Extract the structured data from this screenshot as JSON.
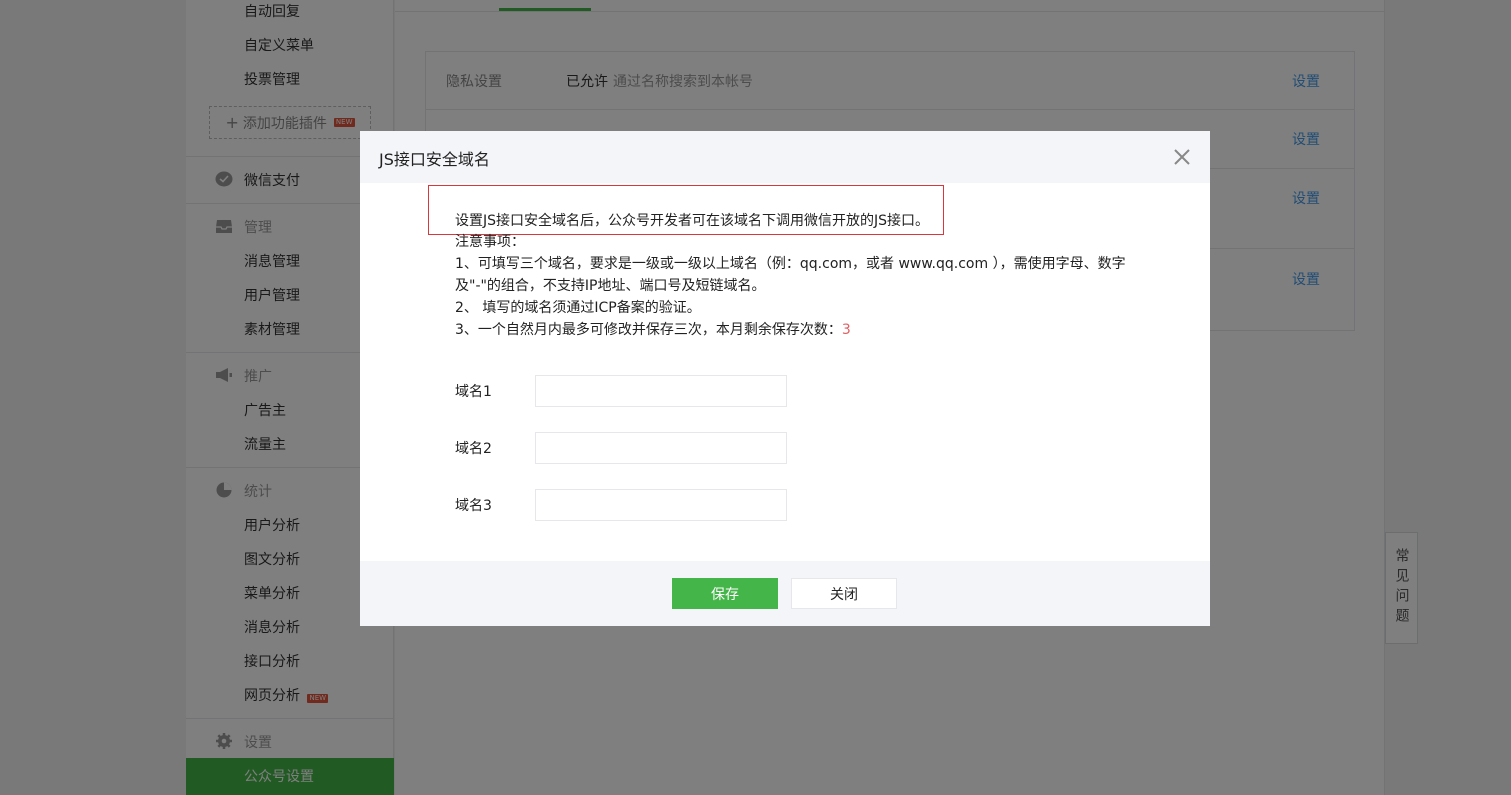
{
  "sidebar": {
    "top_items": [
      "自动回复",
      "自定义菜单",
      "投票管理"
    ],
    "add_plugin_label": "添加功能插件",
    "new_badge": "NEW",
    "wechat_pay": "微信支付",
    "manage_title": "管理",
    "manage_items": [
      "消息管理",
      "用户管理",
      "素材管理"
    ],
    "promo_title": "推广",
    "promo_items": [
      "广告主",
      "流量主"
    ],
    "stats_title": "统计",
    "stats_items": [
      "用户分析",
      "图文分析",
      "菜单分析",
      "消息分析",
      "接口分析",
      "网页分析"
    ],
    "settings_title": "设置",
    "active_item": "公众号设置"
  },
  "main": {
    "rows": [
      {
        "label": "隐私设置",
        "status": "已允许",
        "desc": "通过名称搜索到本帐号",
        "link": "设置"
      },
      {
        "label": "",
        "status": "",
        "desc": "",
        "link": "设置"
      },
      {
        "label": "",
        "status": "",
        "desc": "",
        "link": "设置"
      },
      {
        "label": "",
        "status": "",
        "desc": "",
        "link": "设置"
      }
    ],
    "faq_label": "常见问题"
  },
  "dialog": {
    "title": "JS接口安全域名",
    "intro": "设置JS接口安全域名后，公众号开发者可在该域名下调用微信开放的JS接口。",
    "notes_title": "注意事项：",
    "note1_line1": "1、可填写三个域名，要求是一级或一级以上域名（例：qq.com，或者 www.qq.com ），需使用字母、数字",
    "note1_line2": "及\"-\"的组合，不支持IP地址、端口号及短链域名。",
    "note2": "2、 填写的域名须通过ICP备案的验证。",
    "note3_prefix": "3、一个自然月内最多可修改并保存三次，本月剩余保存次数：",
    "note3_count": "3",
    "fields": [
      {
        "label": "域名1",
        "value": "",
        "placeholder": ""
      },
      {
        "label": "域名2",
        "value": "",
        "placeholder": ""
      },
      {
        "label": "域名3",
        "value": "",
        "placeholder": ""
      }
    ],
    "save_label": "保存",
    "close_label": "关闭"
  },
  "colors": {
    "accent": "#44b549",
    "link": "#459ae9",
    "highlight_border": "#d9363e",
    "count_red": "#e15f63"
  }
}
